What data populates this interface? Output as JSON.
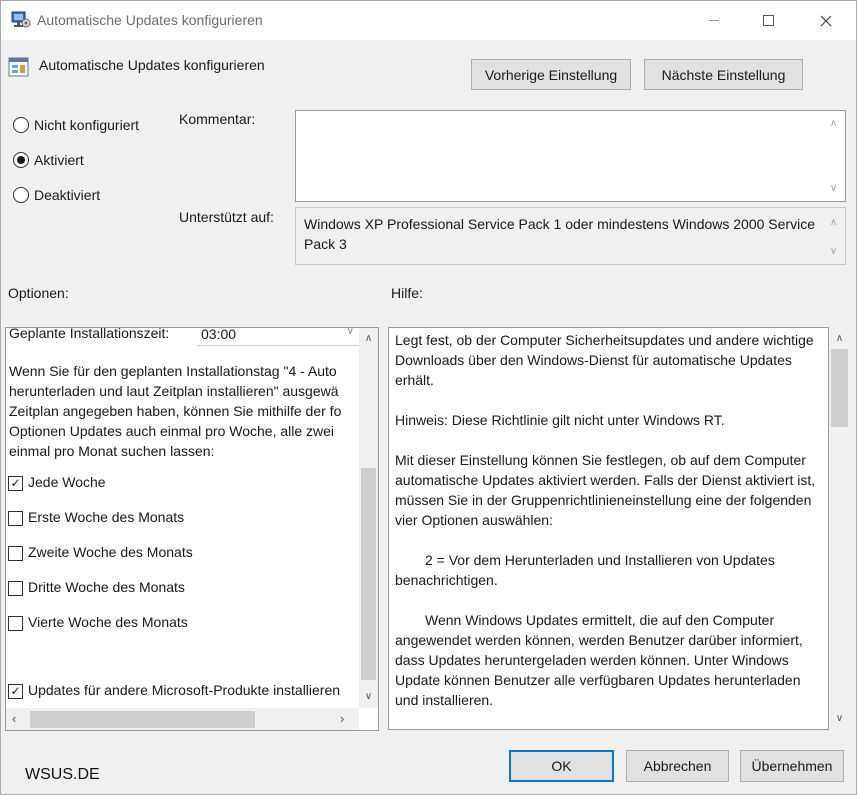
{
  "window": {
    "title": "Automatische Updates konfigurieren",
    "heading": "Automatische Updates konfigurieren"
  },
  "nav": {
    "prev_label": "Vorherige Einstellung",
    "next_label": "Nächste Einstellung"
  },
  "state": {
    "options": [
      "Nicht konfiguriert",
      "Aktiviert",
      "Deaktiviert"
    ],
    "selected": "Aktiviert"
  },
  "comment": {
    "label": "Kommentar:",
    "value": ""
  },
  "supported": {
    "label": "Unterstützt auf:",
    "value": "Windows XP Professional Service Pack 1 oder mindestens Windows 2000 Service Pack 3"
  },
  "options_panel": {
    "label": "Optionen:",
    "install_time_label": "Geplante Installationszeit:",
    "install_time_value": "03:00",
    "description_lines": [
      "Wenn Sie für den geplanten Installationstag \"4 - Auto",
      "herunterladen und laut Zeitplan installieren\" ausgewä",
      "Zeitplan angegeben haben, können Sie mithilfe der fo",
      "Optionen Updates auch einmal pro Woche, alle zwei",
      "einmal pro Monat suchen lassen:"
    ],
    "checkboxes": [
      {
        "label": "Jede Woche",
        "checked": true
      },
      {
        "label": "Erste Woche des Monats",
        "checked": false
      },
      {
        "label": "Zweite Woche des Monats",
        "checked": false
      },
      {
        "label": "Dritte Woche des Monats",
        "checked": false
      },
      {
        "label": "Vierte Woche des Monats",
        "checked": false
      }
    ],
    "other_products": {
      "label": "Updates für andere Microsoft-Produkte installieren",
      "checked": true
    }
  },
  "help_panel": {
    "label": "Hilfe:",
    "paragraphs": [
      "Legt fest, ob der Computer Sicherheitsupdates und andere wichtige Downloads über den Windows-Dienst für automatische Updates erhält.",
      "Hinweis: Diese Richtlinie gilt nicht unter Windows RT.",
      "Mit dieser Einstellung können Sie festlegen, ob auf dem Computer automatische Updates aktiviert werden. Falls der Dienst aktiviert ist, müssen Sie in der Gruppenrichtlinieneinstellung eine der folgenden vier Optionen auswählen:",
      "2 = Vor dem Herunterladen und Installieren von Updates benachrichtigen.",
      "Wenn Windows Updates ermittelt, die auf den Computer angewendet werden können, werden Benutzer darüber informiert, dass Updates heruntergeladen werden können. Unter Windows Update können Benutzer alle verfügbaren Updates herunterladen und installieren."
    ]
  },
  "footer": {
    "watermark": "WSUS.DE",
    "ok_label": "OK",
    "cancel_label": "Abbrechen",
    "apply_label": "Übernehmen"
  },
  "colors": {
    "accent": "#0078d7",
    "dialog_bg": "#f0f0f0"
  }
}
